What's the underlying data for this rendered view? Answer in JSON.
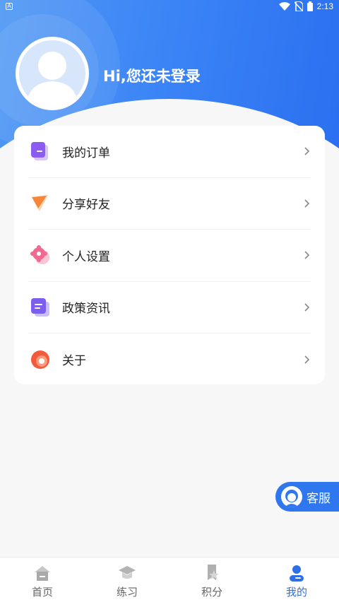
{
  "status_bar": {
    "left_icon": "A",
    "time": "2:13"
  },
  "header": {
    "greeting": "Hi,您还未登录"
  },
  "menu": {
    "items": [
      {
        "label": "我的订单",
        "icon": "order-icon"
      },
      {
        "label": "分享好友",
        "icon": "share-icon"
      },
      {
        "label": "个人设置",
        "icon": "settings-icon"
      },
      {
        "label": "政策资讯",
        "icon": "news-icon"
      },
      {
        "label": "关于",
        "icon": "about-icon"
      }
    ]
  },
  "customer_service": {
    "label": "客服"
  },
  "tabs": [
    {
      "label": "首页",
      "icon": "home-icon",
      "active": false
    },
    {
      "label": "练习",
      "icon": "graduation-cap-icon",
      "active": false
    },
    {
      "label": "积分",
      "icon": "star-badge-icon",
      "active": false
    },
    {
      "label": "我的",
      "icon": "user-icon",
      "active": true
    }
  ],
  "colors": {
    "primary": "#2f77ee",
    "active_tab": "#2e6fe8"
  }
}
